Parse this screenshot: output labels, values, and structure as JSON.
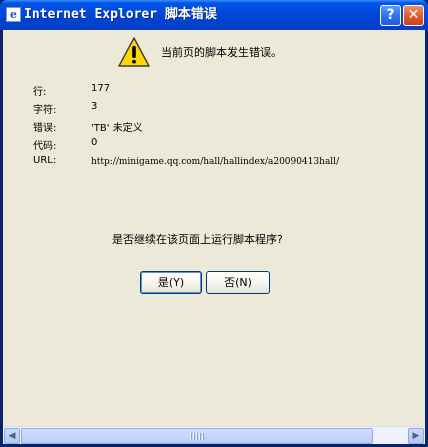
{
  "window": {
    "title": "Internet Explorer 脚本错误",
    "help_label": "?",
    "close_label": "✕",
    "title_icon_glyph": "e"
  },
  "header": {
    "icon": "warning-icon",
    "message": "当前页的脚本发生错误。"
  },
  "details": [
    {
      "label": "行:",
      "value": "177"
    },
    {
      "label": "字符:",
      "value": "3"
    },
    {
      "label": "错误:",
      "value": "'TB' 未定义"
    },
    {
      "label": "代码:",
      "value": "0"
    },
    {
      "label": "URL:",
      "value": "http://minigame.qq.com/hall/hallindex/a20090413hall/"
    }
  ],
  "prompt": "是否继续在该页面上运行脚本程序?",
  "buttons": {
    "yes": "是(Y)",
    "no": "否(N)"
  },
  "scrollbar": {
    "left_arrow": "◀",
    "right_arrow": "▶"
  },
  "colors": {
    "title_bar": "#0046d8",
    "dialog_bg": "#ece9d8",
    "close_button": "#e05a2a",
    "warning_yellow": "#ffd800"
  }
}
